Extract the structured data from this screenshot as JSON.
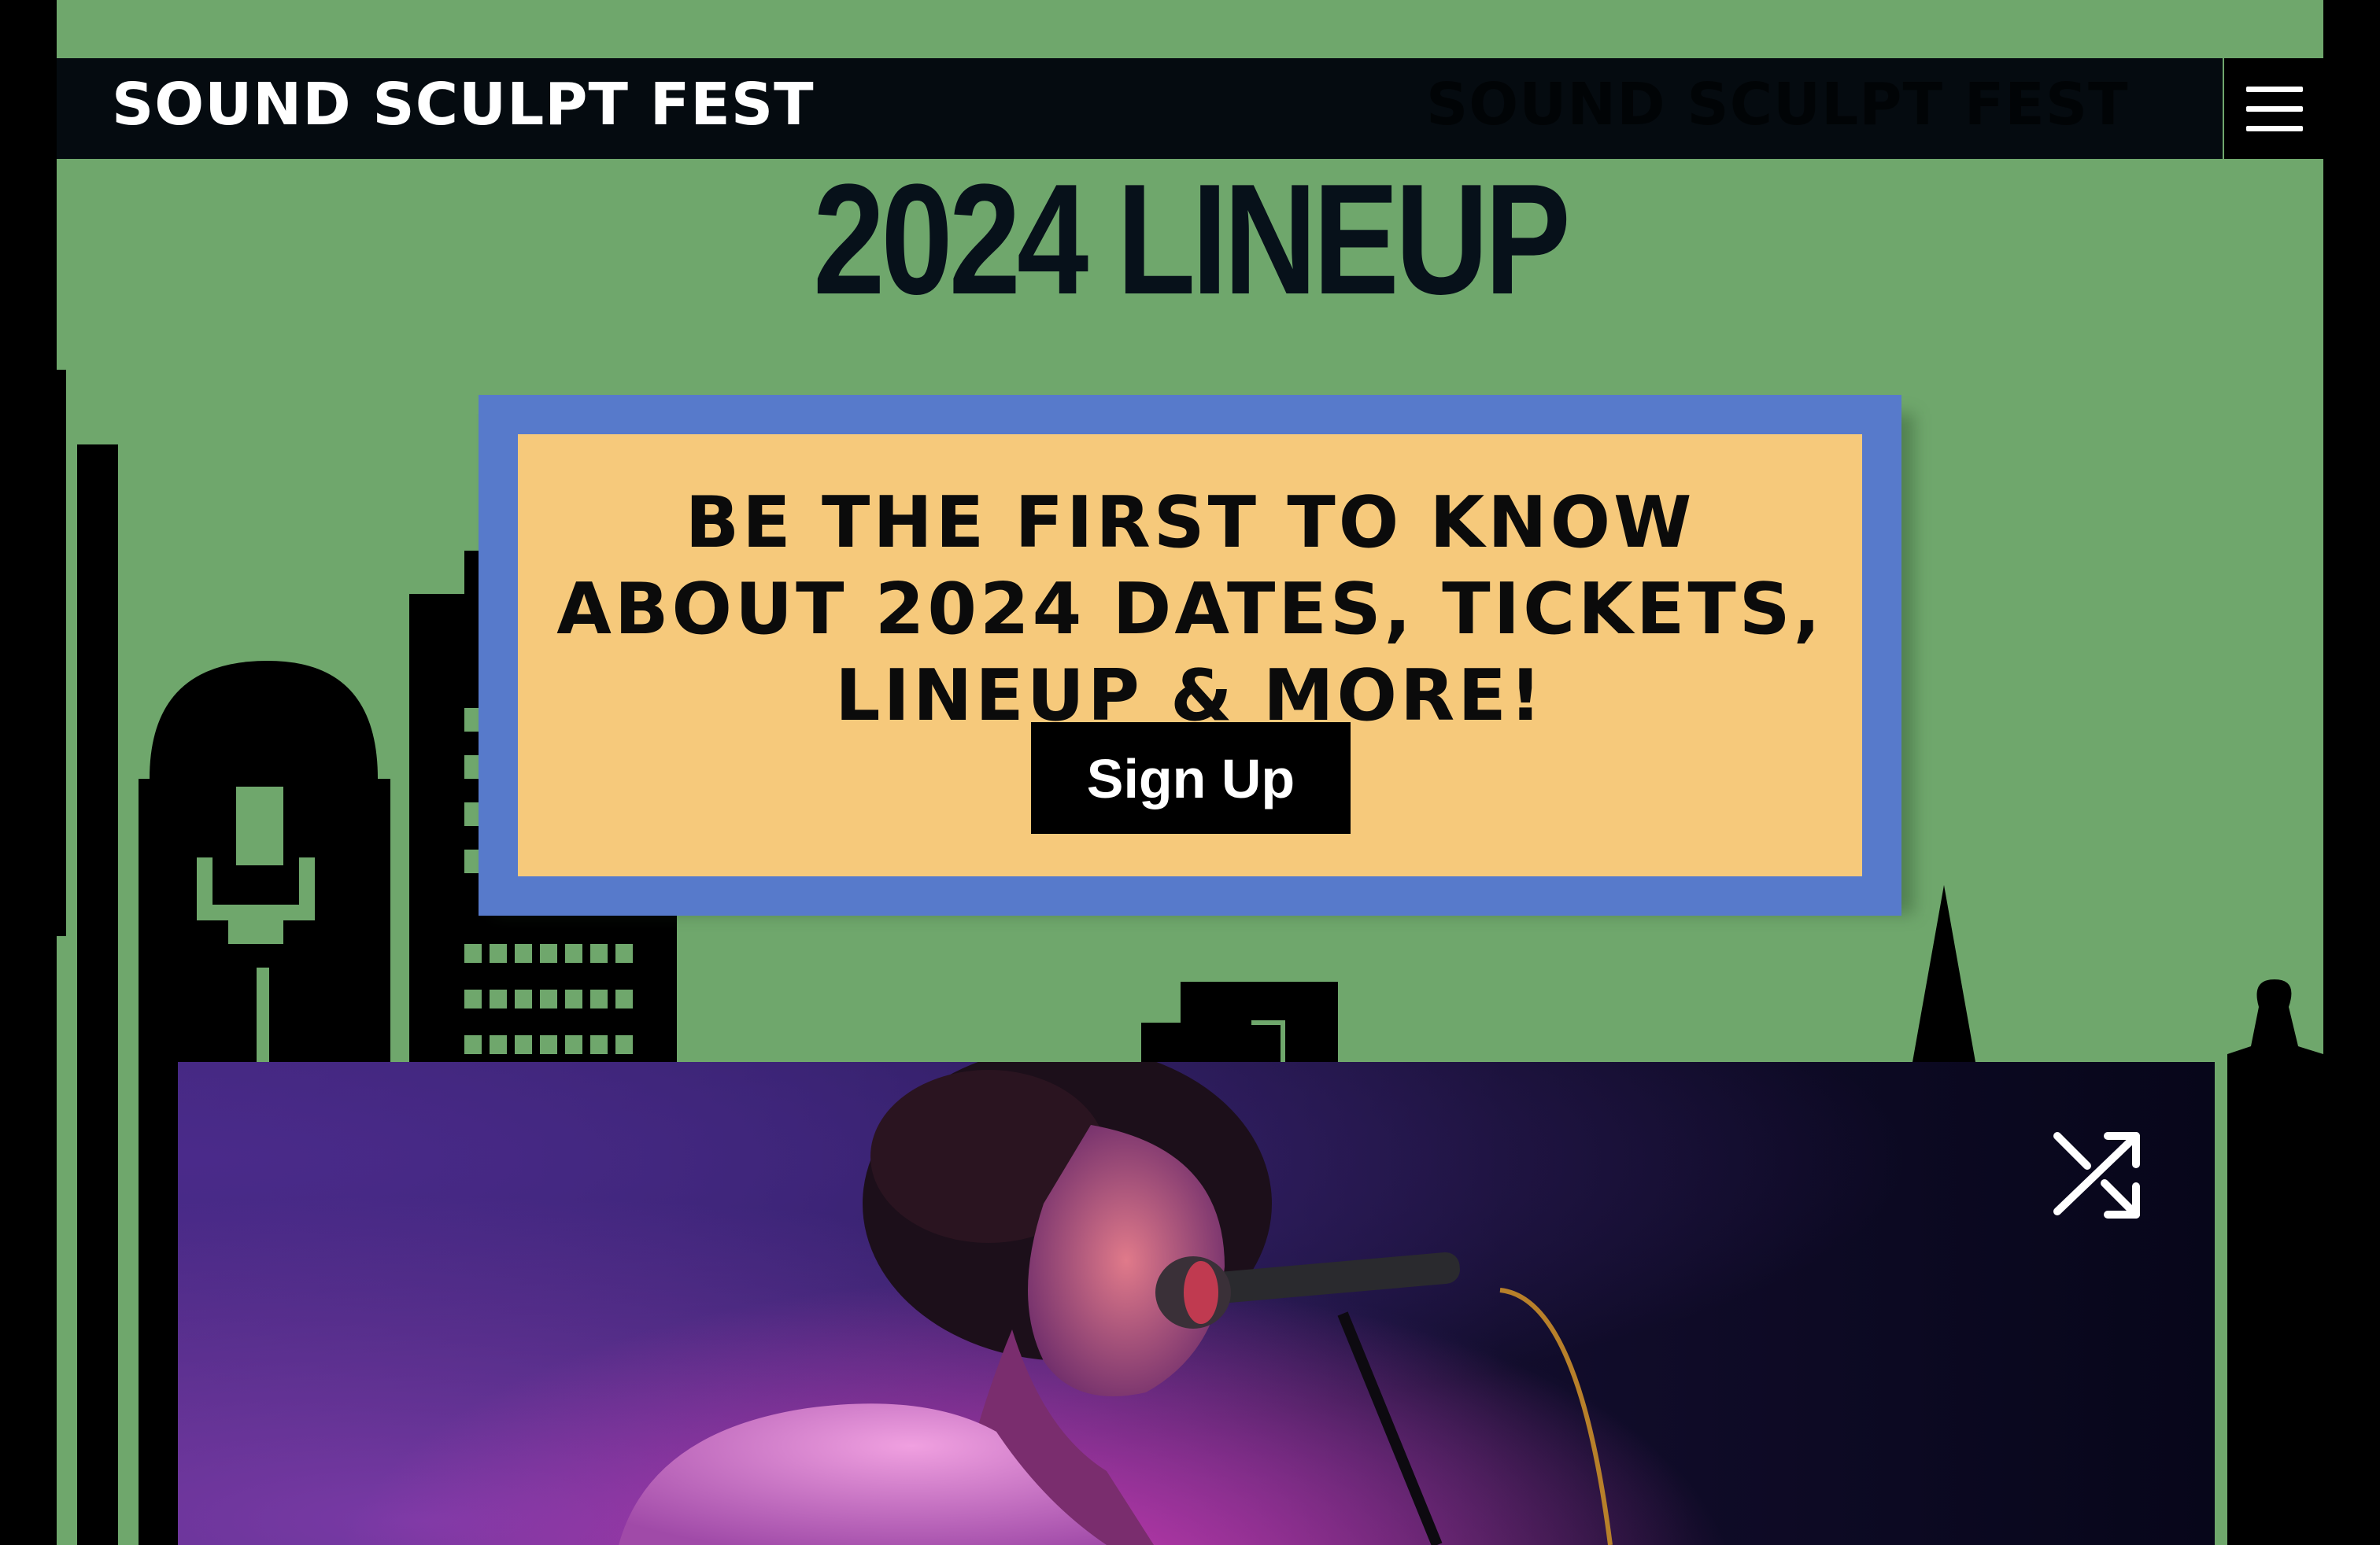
{
  "header": {
    "logo_text": "SOUND SCULPT FEST",
    "logo_ghost_text": "SOUND SCULPT FEST",
    "menu_icon": "hamburger-menu-icon"
  },
  "hero": {
    "title": "2024 LINEUP"
  },
  "promo": {
    "line1": "BE THE FIRST TO KNOW",
    "line2": "ABOUT 2024 DATES, TICKETS,",
    "line3": "LINEUP & MORE!",
    "signup_label": "Sign Up"
  },
  "media": {
    "shuffle_icon": "shuffle-icon"
  },
  "colors": {
    "background": "#6fa76c",
    "promo_border": "#577acb",
    "promo_fill": "#f6c97b",
    "bar": "#050b10"
  }
}
